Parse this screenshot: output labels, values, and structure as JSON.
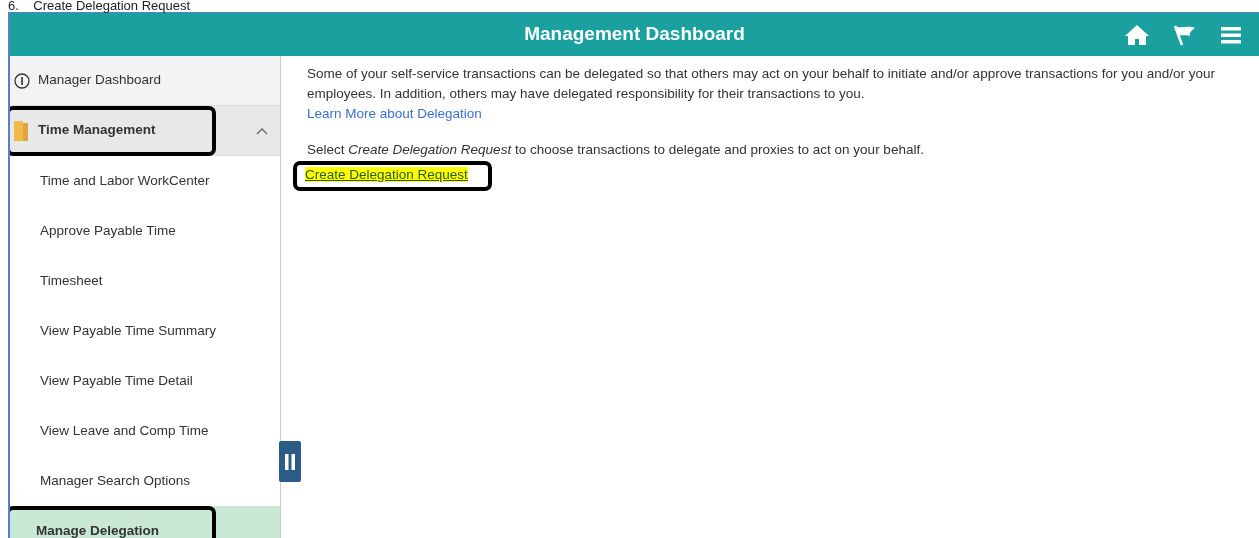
{
  "document_heading": "6.    Create Delegation Request",
  "header": {
    "title": "Management Dashboard"
  },
  "sidebar": {
    "items": [
      {
        "kind": "link",
        "label": "Manager Dashboard",
        "selected": false,
        "annotated": false
      },
      {
        "kind": "group",
        "label": "Time Management",
        "expanded": true,
        "selected": false,
        "annotated": true
      },
      {
        "kind": "subitem",
        "label": "Time and Labor WorkCenter",
        "selected": false,
        "annotated": false
      },
      {
        "kind": "subitem",
        "label": "Approve Payable Time",
        "selected": false,
        "annotated": false
      },
      {
        "kind": "subitem",
        "label": "Timesheet",
        "selected": false,
        "annotated": false
      },
      {
        "kind": "subitem",
        "label": "View Payable Time Summary",
        "selected": false,
        "annotated": false
      },
      {
        "kind": "subitem",
        "label": "View Payable Time Detail",
        "selected": false,
        "annotated": false
      },
      {
        "kind": "subitem",
        "label": "View Leave and Comp Time",
        "selected": false,
        "annotated": false
      },
      {
        "kind": "subitem",
        "label": "Manager Search Options",
        "selected": false,
        "annotated": false
      },
      {
        "kind": "subitem",
        "label": "Manage Delegation",
        "selected": true,
        "annotated": true
      }
    ]
  },
  "content": {
    "intro": "Some of your self-service transactions can be delegated so that others may act on your behalf to initiate and/or approve transactions for you and/or your employees. In addition, others may have delegated responsibility for their transactions to you.",
    "learn_more_link": "Learn More about Delegation",
    "instruction": "Select *Create Delegation Request* to choose transactions to delegate and proxies to act on your behalf.",
    "create_link": {
      "label": "Create Delegation Request",
      "highlighted": true,
      "annotated": true
    }
  }
}
